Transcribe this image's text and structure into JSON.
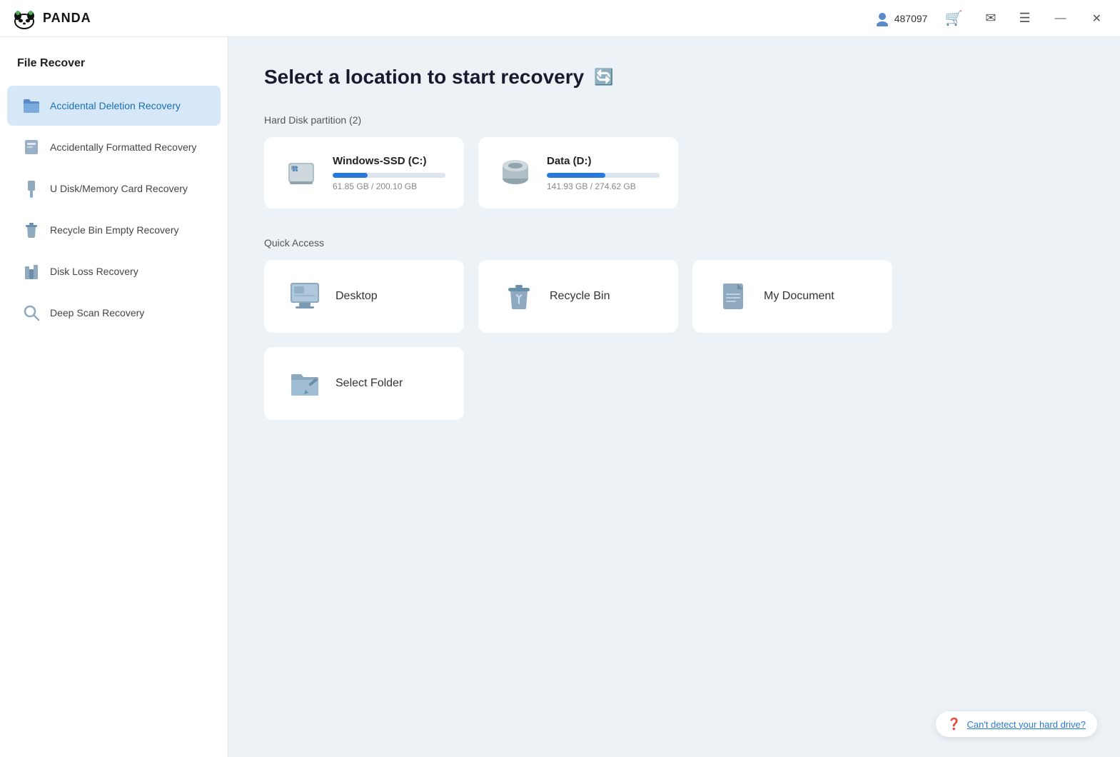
{
  "titlebar": {
    "logo_text": "PANDA",
    "user_id": "487097",
    "cart_icon": "🛒",
    "mail_icon": "✉",
    "menu_icon": "☰",
    "minimize_icon": "—",
    "close_icon": "✕"
  },
  "sidebar": {
    "section_title": "File Recover",
    "items": [
      {
        "id": "accidental",
        "label": "Accidental Deletion Recovery",
        "active": true
      },
      {
        "id": "formatted",
        "label": "Accidentally Formatted Recovery",
        "active": false
      },
      {
        "id": "udisk",
        "label": "U Disk/Memory Card Recovery",
        "active": false
      },
      {
        "id": "recycle",
        "label": "Recycle Bin Empty Recovery",
        "active": false
      },
      {
        "id": "disk-loss",
        "label": "Disk Loss Recovery",
        "active": false
      },
      {
        "id": "deep-scan",
        "label": "Deep Scan Recovery",
        "active": false
      }
    ]
  },
  "content": {
    "page_title": "Select a location to start recovery",
    "hard_disk_label": "Hard Disk partition",
    "hard_disk_count": "(2)",
    "drives": [
      {
        "name": "Windows-SSD  (C:)",
        "used_gb": 61.85,
        "total_gb": 200.1,
        "used_label": "61.85 GB / 200.10 GB",
        "fill_percent": 31
      },
      {
        "name": "Data  (D:)",
        "used_gb": 141.93,
        "total_gb": 274.62,
        "used_label": "141.93 GB / 274.62 GB",
        "fill_percent": 52
      }
    ],
    "quick_access_label": "Quick Access",
    "quick_access_items": [
      {
        "id": "desktop",
        "label": "Desktop"
      },
      {
        "id": "recycle-bin",
        "label": "Recycle Bin"
      },
      {
        "id": "my-document",
        "label": "My Document"
      },
      {
        "id": "select-folder",
        "label": "Select Folder"
      }
    ],
    "help_text": "Can't detect your hard drive?"
  }
}
